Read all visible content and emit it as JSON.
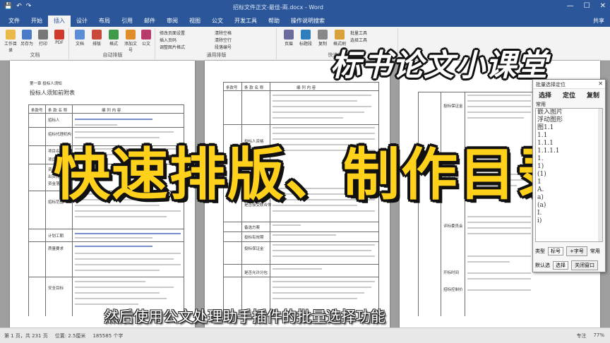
{
  "window": {
    "title": "招标文件正文-最佳-兩.docx - Word",
    "qat_icons": [
      "save-icon",
      "undo-icon",
      "redo-icon"
    ],
    "controls": [
      "—",
      "☐",
      "✕"
    ]
  },
  "tabs": [
    "文件",
    "开始",
    "插入",
    "设计",
    "布局",
    "引用",
    "邮件",
    "审阅",
    "视图",
    "公文",
    "开发工具",
    "帮助",
    "操作说明搜索"
  ],
  "active_tab_index": 2,
  "share_label": "共享",
  "ribbon": {
    "group_document": "文档",
    "group_autoformat": "自动排版",
    "group_common": "通用排版",
    "group_quick": "快速排版",
    "buttons": [
      "工作目录",
      "另存为",
      "打印",
      "PDF",
      "文档",
      "排版",
      "格式",
      "添加文号",
      "公文",
      "页眉",
      "标题段",
      "复制",
      "格式刷"
    ],
    "small_items": [
      "修改页面设置",
      "插入页码",
      "调整图片格式",
      "清除空格",
      "清除空行",
      "段落编号",
      "批量工具",
      "选择工具"
    ]
  },
  "doc_pages": {
    "p1": {
      "heading": "第一章 投标人须知",
      "subheading": "投标人须知前附表",
      "col_item": "条款号",
      "col_name": "条 款 名 称",
      "col_content": "编 列 内 容",
      "rows": [
        "招标人",
        "招标代理机构",
        "项目名称",
        "项目地点",
        "资金来源",
        "出资比例",
        "资金落实情况",
        "招标范围",
        "计划工期",
        "质量要求",
        "安全目标"
      ]
    },
    "p2": {
      "col_item": "条款号",
      "col_name": "条 款 名 称",
      "col_content": "编 列 内 容",
      "rows": [
        "投标人资格",
        "是否接受联合体",
        "踏勘现场",
        "投标预备会",
        "投标截止时间",
        "备选方案",
        "投标有效期",
        "投标保证金",
        "是否允许分包"
      ]
    },
    "p3": {
      "rows": [
        "投标保证金",
        "联系方式",
        "开标时间",
        "开标地点",
        "评标委员会",
        "招标控制价"
      ]
    }
  },
  "brand_text": "标书论文小课堂",
  "headline_text": "快速排版、制作目录",
  "subtitle_text": "然后使用公文处理助手插件的批量选择功能",
  "panel": {
    "title": "批量选择定位",
    "tabs": [
      "选择",
      "定位",
      "复制"
    ],
    "section_label": "常用",
    "items": [
      "嵌入图片",
      "浮动图形",
      "图1.1",
      "1.1",
      "1.1.1",
      "1.1.1.1",
      "1.",
      "1)",
      "(1)",
      "1",
      "A.",
      "a)",
      "(a)",
      "I.",
      "i)"
    ],
    "type_label": "类型",
    "type_value": "标号",
    "add_button": "+字号",
    "common_label": "常用",
    "default_label": "默认选",
    "default_value": "选择",
    "close_button": "关闭窗口"
  },
  "statusbar": {
    "page": "第 1 页，共 231 页",
    "words": "185585 个字",
    "position": "位置: 2.5厘米",
    "focus": "专注",
    "zoom": "77%"
  }
}
